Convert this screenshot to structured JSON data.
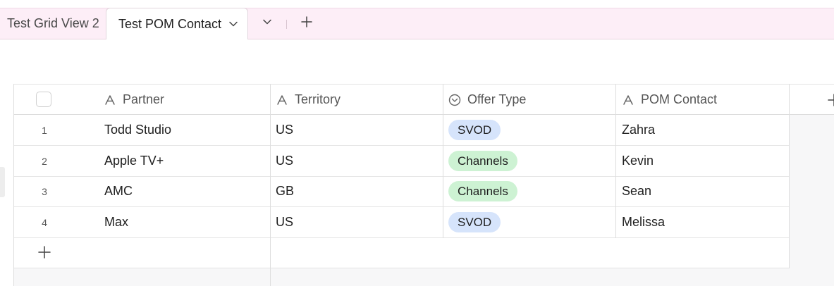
{
  "tabs": {
    "inactive_label": "Test Grid View 2",
    "active_label": "Test POM Contact",
    "icons": {
      "active_dropdown": "chevron-down-icon",
      "more_views": "chevron-down-icon",
      "add_view": "plus-icon"
    }
  },
  "grid": {
    "columns": [
      {
        "label": "Partner",
        "icon": "text-field-icon"
      },
      {
        "label": "Territory",
        "icon": "text-field-icon"
      },
      {
        "label": "Offer Type",
        "icon": "single-select-icon"
      },
      {
        "label": "POM Contact",
        "icon": "text-field-icon"
      }
    ],
    "rows": [
      {
        "num": "1",
        "partner": "Todd Studio",
        "territory": "US",
        "offer_type": "SVOD",
        "pom_contact": "Zahra"
      },
      {
        "num": "2",
        "partner": "Apple TV+",
        "territory": "US",
        "offer_type": "Channels",
        "pom_contact": "Kevin"
      },
      {
        "num": "3",
        "partner": "AMC",
        "territory": "GB",
        "offer_type": "Channels",
        "pom_contact": "Sean"
      },
      {
        "num": "4",
        "partner": "Max",
        "territory": "US",
        "offer_type": "SVOD",
        "pom_contact": "Melissa"
      }
    ],
    "tag_colors": {
      "SVOD": "#d6e4fb",
      "Channels": "#cdf2d3"
    }
  }
}
